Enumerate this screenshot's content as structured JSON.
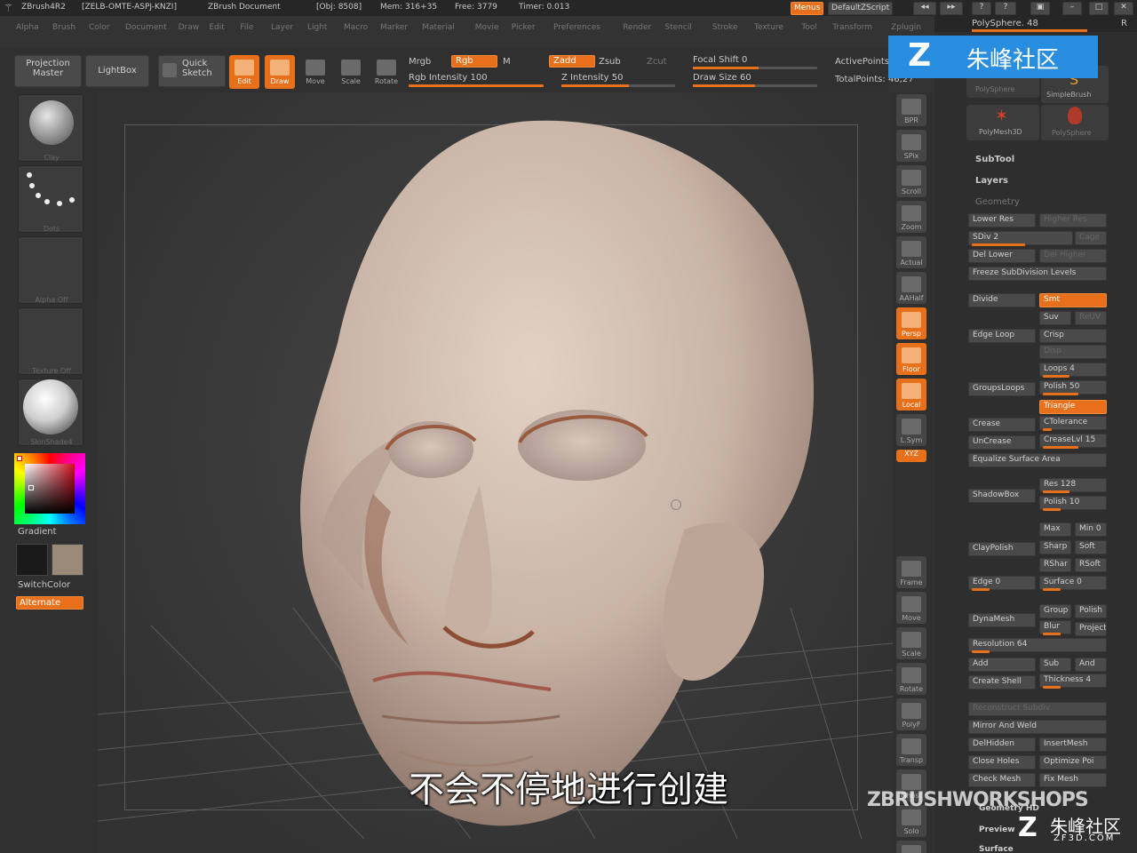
{
  "titlebar": {
    "app": "ZBrush4R2",
    "serial": "[ZELB-OMTE-ASPJ-KNZI]",
    "doc": "ZBrush Document",
    "obj": "[Obj: 8508]",
    "mem": "Mem: 316+35",
    "free": "Free: 3779",
    "timer": "Timer: 0.013",
    "menus": "Menus",
    "script": "DefaultZScript"
  },
  "menubar": [
    "Alpha",
    "Brush",
    "Color",
    "Document",
    "Draw",
    "Edit",
    "File",
    "Layer",
    "Light",
    "Macro",
    "Marker",
    "Material",
    "Movie",
    "Picker",
    "Preferences",
    "Render",
    "Stencil",
    "Stroke",
    "Texture",
    "Tool",
    "Transform",
    "Zplugin",
    "Zscript"
  ],
  "toolbar": {
    "projection_master": "Projection Master",
    "lightbox": "LightBox",
    "quick_sketch": "Quick Sketch",
    "edit": "Edit",
    "draw": "Draw",
    "move": "Move",
    "scale": "Scale",
    "rotate": "Rotate",
    "mrgb": "Mrgb",
    "rgb": "Rgb",
    "m": "M",
    "rgb_intensity": "Rgb Intensity 100",
    "zadd": "Zadd",
    "zsub": "Zsub",
    "zcut": "Zcut",
    "z_intensity": "Z Intensity 50",
    "focal_shift": "Focal Shift 0",
    "draw_size": "Draw Size 60",
    "active_points": "ActivePoints:",
    "total_points": "TotalPoints: 46,27"
  },
  "left_panel": {
    "gradient": "Gradient",
    "switchcolor": "SwitchColor",
    "alternate": "Alternate",
    "brush_label": "Clay",
    "stroke_label": "Dots",
    "alpha_label": "Alpha Off",
    "texture_label": "Texture Off",
    "material_label": "SkinShade4"
  },
  "right_toolbar": [
    "BPR",
    "SPix",
    "Scroll",
    "Zoom",
    "Actual",
    "AAHalf",
    "Persp",
    "Floor",
    "Local",
    "L.Sym",
    "XYZ",
    "",
    "",
    "Frame",
    "Move",
    "Scale",
    "Rotate",
    "PolyF",
    "Transp",
    "Ghost",
    "Solo",
    "Xpose"
  ],
  "right_panel": {
    "polysphere": "PolySphere. 48",
    "thumbs": [
      "PolySphere",
      "SimpleBrush",
      "PolyMesh3D",
      "PolySphere"
    ],
    "subtool": "SubTool",
    "layers": "Layers",
    "geometry": "Geometry",
    "lower_res": "Lower Res",
    "higher_res": "Higher Res",
    "sdiv": "SDiv 2",
    "cage": "Cage",
    "del_lower": "Del Lower",
    "del_higher": "Del Higher",
    "freeze": "Freeze SubDivision Levels",
    "divide": "Divide",
    "smt": "Smt",
    "suv": "Suv",
    "reuv": "ReUV",
    "edge_loop": "Edge Loop",
    "crisp": "Crisp",
    "disp": "Disp",
    "loops": "Loops 4",
    "grouploops": "GroupsLoops",
    "polish": "Polish 50",
    "triangle": "Triangle",
    "crease": "Crease",
    "ctolerance": "CTolerance",
    "uncrease": "UnCrease",
    "creaselvl": "CreaseLvl 15",
    "equalize": "Equalize Surface Area",
    "shadowbox": "ShadowBox",
    "res": "Res 128",
    "polish10": "Polish 10",
    "claypolish": "ClayPolish",
    "max": "Max",
    "min": "Min 0",
    "sharp": "Sharp",
    "soft": "Soft",
    "rshar": "RShar",
    "rsoft": "RSoft",
    "edge0": "Edge 0",
    "surface0": "Surface 0",
    "dynamesh": "DynaMesh",
    "group": "Group",
    "polish2": "Polish",
    "blur": "Blur",
    "project": "Project",
    "resolution": "Resolution 64",
    "add": "Add",
    "sub": "Sub",
    "and": "And",
    "create_shell": "Create Shell",
    "thickness": "Thickness 4",
    "reconstruct": "Reconstruct Subdiv",
    "mirror_weld": "Mirror And Weld",
    "delhidden": "DelHidden",
    "insertmesh": "InsertMesh",
    "close_holes": "Close Holes",
    "optimize": "Optimize Poi",
    "check_mesh": "Check Mesh",
    "fix_mesh": "Fix Mesh",
    "geometry_hd": "Geometry HD",
    "preview": "Preview",
    "surface": "Surface"
  },
  "watermarks": {
    "top_logo": "朱峰社区",
    "zbw": "ZBRUSHWORKSHOPS",
    "bottom_logo": "朱峰社区",
    "bottom_url": "ZF3D.COM"
  },
  "subtitle": "不会不停地进行创建",
  "colors": {
    "accent": "#e8701a",
    "canvas": "#3a3a3a",
    "skin": "#c9b4a6",
    "logo_blue": "#2a8ee0"
  }
}
